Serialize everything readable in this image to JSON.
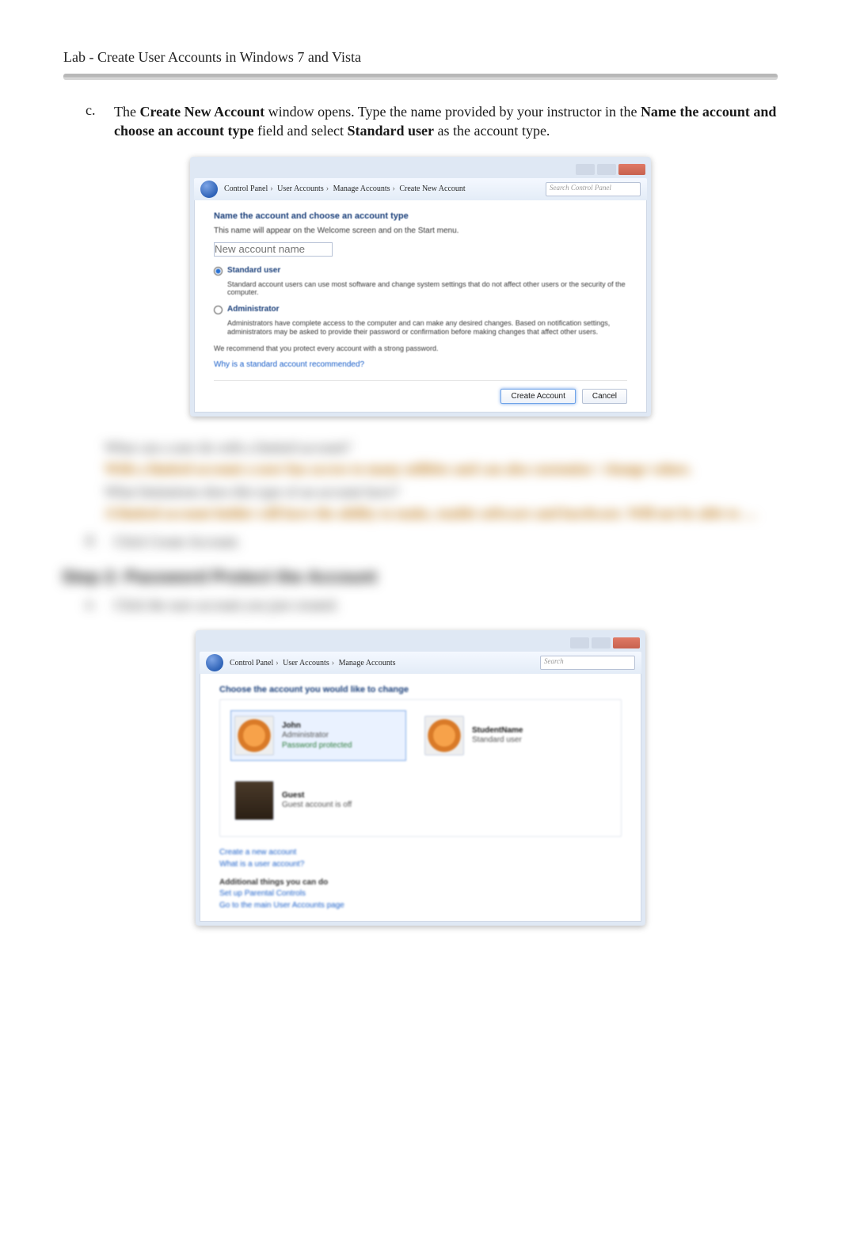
{
  "header": {
    "lab_title": "Lab - Create User Accounts in Windows 7 and Vista"
  },
  "step_c": {
    "marker": "c.",
    "t1": "The ",
    "b1": "Create New Account",
    "t2": " window opens. Type the name provided by your instructor in the ",
    "b2": "Name the account and choose an account type",
    "t3": " field and select ",
    "b3": "Standard user",
    "t4": " as the account type."
  },
  "fig1": {
    "breadcrumb": {
      "c1": "Control Panel",
      "c2": "User Accounts",
      "c3": "Manage Accounts",
      "c4": "Create New Account"
    },
    "search_placeholder": "Search Control Panel",
    "heading": "Name the account and choose an account type",
    "sub": "This name will appear on the Welcome screen and on the Start menu.",
    "input_placeholder": "New account name",
    "opt_standard": {
      "label": "Standard user",
      "desc": "Standard account users can use most software and change system settings that do not affect other users or the security of the computer."
    },
    "opt_admin": {
      "label": "Administrator",
      "desc": "Administrators have complete access to the computer and can make any desired changes. Based on notification settings, administrators may be asked to provide their password or confirmation before making changes that affect other users."
    },
    "recommend": "We recommend that you protect every account with a strong password.",
    "why_link": "Why is a standard account recommended?",
    "btn_primary": "Create Account",
    "btn_cancel": "Cancel"
  },
  "qa": {
    "q1": "What can a user do with a limited account?",
    "a1": "With a limited account a user has access to many utilities and can also customize / change values.",
    "q2": "What limitations does this type of an account have?",
    "a2": "A limited account holder will have the ability to make, enable software and hardware. Will not be able to …"
  },
  "step_d": {
    "marker": "d.",
    "text": "Click Create Account."
  },
  "step2_heading": "Step 2:   Password Protect the Account",
  "step2_a": {
    "marker": "a.",
    "text": "Click the user account you just created."
  },
  "fig2": {
    "breadcrumb": {
      "c1": "Control Panel",
      "c2": "User Accounts",
      "c3": "Manage Accounts"
    },
    "search_placeholder": "Search",
    "prompt": "Choose the account you would like to change",
    "accounts": [
      {
        "name": "John",
        "type": "Administrator",
        "protected": "Password protected",
        "pic": "flower",
        "selected": true
      },
      {
        "name": "StudentName",
        "type": "Standard user",
        "protected": "",
        "pic": "flower",
        "selected": false
      },
      {
        "name": "Guest",
        "type": "Guest account is off",
        "protected": "",
        "pic": "chess",
        "selected": false
      }
    ],
    "links_left": [
      "Create a new account",
      "What is a user account?"
    ],
    "other_heading": "Additional things you can do",
    "other_links": [
      "Set up Parental Controls",
      "Go to the main User Accounts page"
    ]
  }
}
